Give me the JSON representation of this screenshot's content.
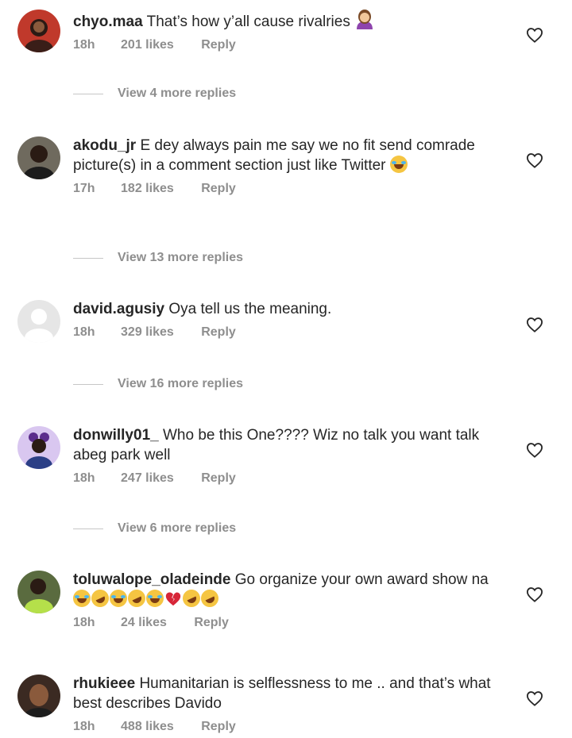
{
  "comments": [
    {
      "username": "chyo.maa",
      "text": "That’s how y’all cause rivalries",
      "emojis": [
        "woman-gesturing-icon"
      ],
      "time": "18h",
      "likes": "201 likes",
      "reply": "Reply",
      "view_replies": "View 4 more replies"
    },
    {
      "username": "akodu_jr",
      "text": "E dey always pain me say we no fit send comrade picture(s) in a comment section just like Twitter",
      "emojis": [
        "laughing-tears-icon"
      ],
      "time": "17h",
      "likes": "182 likes",
      "reply": "Reply",
      "view_replies": "View 13 more replies"
    },
    {
      "username": "david.agusiy",
      "text": "Oya tell us the meaning.",
      "emojis": [],
      "time": "18h",
      "likes": "329 likes",
      "reply": "Reply",
      "view_replies": "View 16 more replies"
    },
    {
      "username": "donwilly01_",
      "text": "Who be this One???? Wiz no talk you want talk abeg park well",
      "emojis": [],
      "time": "18h",
      "likes": "247 likes",
      "reply": "Reply",
      "view_replies": "View 6 more replies"
    },
    {
      "username": "toluwalope_oladeinde",
      "text": "Go organize your own award show na",
      "emojis": [
        "laughing-tears-icon",
        "rofl-icon",
        "laughing-tears-icon",
        "rofl-icon",
        "laughing-tears-icon",
        "broken-heart-icon",
        "rofl-icon",
        "rofl-icon"
      ],
      "time": "18h",
      "likes": "24 likes",
      "reply": "Reply",
      "view_replies": ""
    },
    {
      "username": "rhukieee",
      "text": "Humanitarian is selflessness to me .. and that’s what best describes Davido",
      "emojis": [],
      "time": "18h",
      "likes": "488 likes",
      "reply": "Reply",
      "view_replies": ""
    }
  ],
  "colors": {
    "text": "#262626",
    "meta": "#8e8e8e",
    "divider": "#c7c7c7"
  }
}
